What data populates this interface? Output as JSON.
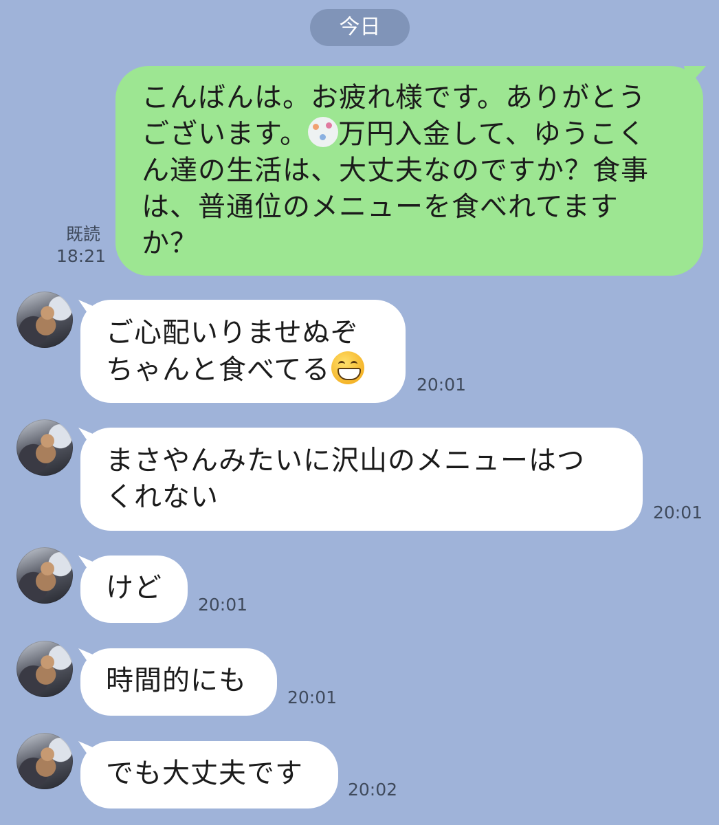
{
  "date_separator": "今日",
  "outgoing": {
    "text": "こんばんは。お疲れ様です。ありがとう\nございます。",
    "text_after_emoji": "万円入金して、ゆうこく\nん達の生活は、大丈夫なのですか？食事\nは、普通位のメニューを食べれてます\nか？",
    "read_label": "既読",
    "time": "18:21",
    "emoji": "money-emoji"
  },
  "incoming": [
    {
      "text": "ご心配いりませぬぞ\nちゃんと食べてる",
      "emoji": "grinning-face-emoji",
      "time": "20:01"
    },
    {
      "text": "まさやんみたいに沢山のメニューはつ\nくれない",
      "time": "20:01"
    },
    {
      "text": "けど",
      "time": "20:01"
    },
    {
      "text": "時間的にも",
      "time": "20:01"
    },
    {
      "text": "でも大丈夫です",
      "time": "20:02"
    }
  ],
  "colors": {
    "background": "#9fb3d9",
    "outgoing_bubble": "#9de692",
    "incoming_bubble": "#ffffff",
    "date_pill": "#8094b8"
  }
}
